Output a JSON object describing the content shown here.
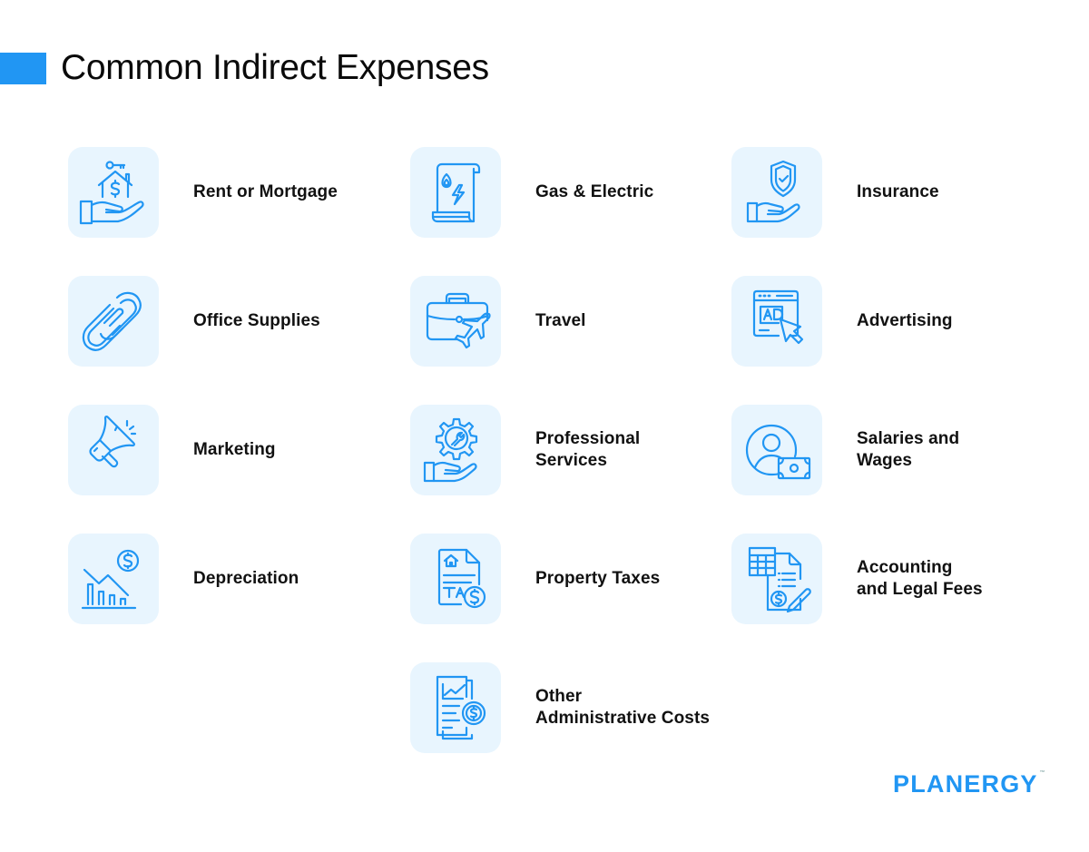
{
  "header": {
    "title": "Common Indirect Expenses",
    "accent_color": "#2196f3"
  },
  "theme": {
    "icon_color": "#2196f3",
    "tile_background": "#e8f5fe",
    "text_color": "#111111"
  },
  "items": [
    {
      "icon": "house-key-hand-icon",
      "lines": [
        "Rent or Mortgage"
      ]
    },
    {
      "icon": "utility-bill-icon",
      "lines": [
        "Gas & Electric"
      ]
    },
    {
      "icon": "shield-hand-icon",
      "lines": [
        "Insurance"
      ]
    },
    {
      "icon": "paperclip-icon",
      "lines": [
        "Office Supplies"
      ]
    },
    {
      "icon": "briefcase-plane-icon",
      "lines": [
        "Travel"
      ]
    },
    {
      "icon": "ad-browser-cursor-icon",
      "lines": [
        "Advertising"
      ]
    },
    {
      "icon": "megaphone-icon",
      "lines": [
        "Marketing"
      ]
    },
    {
      "icon": "gear-wrench-hand-icon",
      "lines": [
        "Professional",
        "Services"
      ]
    },
    {
      "icon": "person-money-icon",
      "lines": [
        "Salaries and",
        "Wages"
      ]
    },
    {
      "icon": "declining-chart-dollar-icon",
      "lines": [
        "Depreciation"
      ]
    },
    {
      "icon": "tax-document-icon",
      "lines": [
        "Property Taxes"
      ]
    },
    {
      "icon": "spreadsheet-document-pen-icon",
      "lines": [
        "Accounting",
        "and Legal Fees"
      ]
    },
    {
      "icon": "report-dollar-icon",
      "lines": [
        "Other",
        "Administrative Costs"
      ]
    }
  ],
  "brand": {
    "logo_text": "PLANERGY",
    "trademark": "™"
  }
}
